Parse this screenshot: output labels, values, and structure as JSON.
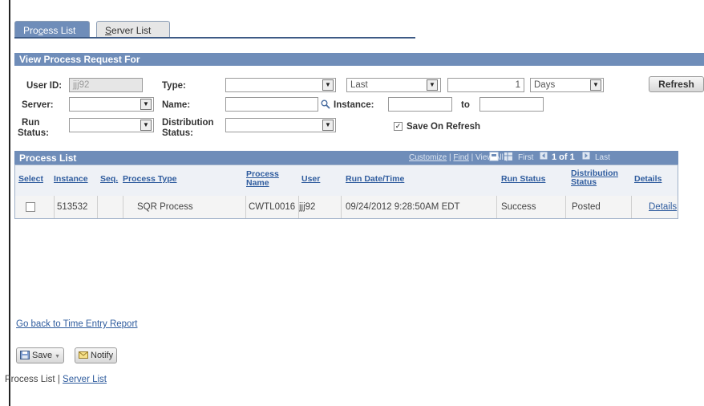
{
  "tabs": {
    "process_list": {
      "pre": "Pro",
      "ul": "c",
      "post": "ess List"
    },
    "server_list": {
      "ul": "S",
      "post": "erver List"
    }
  },
  "criteria": {
    "section_title": "View Process Request For",
    "user_id_label": "User ID:",
    "user_id_value": "jjj92",
    "type_label": "Type:",
    "type_value": "",
    "range_value": "Last",
    "range_number": "1",
    "range_unit": "Days",
    "refresh_label": "Refresh",
    "server_label": "Server:",
    "server_value": "",
    "name_label": "Name:",
    "name_value": "",
    "instance_label": "Instance:",
    "instance_from": "",
    "to_label": "to",
    "instance_to": "",
    "run_status_label_1": "Run",
    "run_status_label_2": "Status:",
    "run_status_value": "",
    "distribution_label_1": "Distribution",
    "distribution_label_2": "Status:",
    "distribution_value": "",
    "save_on_refresh_label": "Save On Refresh",
    "save_on_refresh_checked": true
  },
  "grid": {
    "title": "Process List",
    "nav": {
      "customize": "Customize",
      "find": "Find",
      "view_all": "View All",
      "first": "First",
      "range": "1 of 1",
      "last": "Last"
    },
    "columns": {
      "select": "Select",
      "instance": "Instance",
      "seq": "Seq.",
      "process_type": "Process Type",
      "process_name_1": "Process",
      "process_name_2": "Name",
      "user": "User",
      "run_datetime": "Run Date/Time",
      "run_status": "Run Status",
      "distribution_1": "Distribution",
      "distribution_2": "Status",
      "details": "Details"
    },
    "rows": [
      {
        "instance": "513532",
        "seq": "",
        "process_type": "SQR Process",
        "process_name": "CWTL0016",
        "user": "jjj92",
        "run_datetime": "09/24/2012  9:28:50AM EDT",
        "run_status": "Success",
        "distribution_status": "Posted",
        "details": "Details"
      }
    ]
  },
  "back_link": "Go back to Time Entry Report",
  "buttons": {
    "save": "Save",
    "notify": "Notify"
  },
  "footer": {
    "process_list": "Process List",
    "separator": " | ",
    "server_list": "Server List"
  },
  "colors": {
    "header_blue": "#6f8db9",
    "link_blue": "#2f5c9e"
  }
}
